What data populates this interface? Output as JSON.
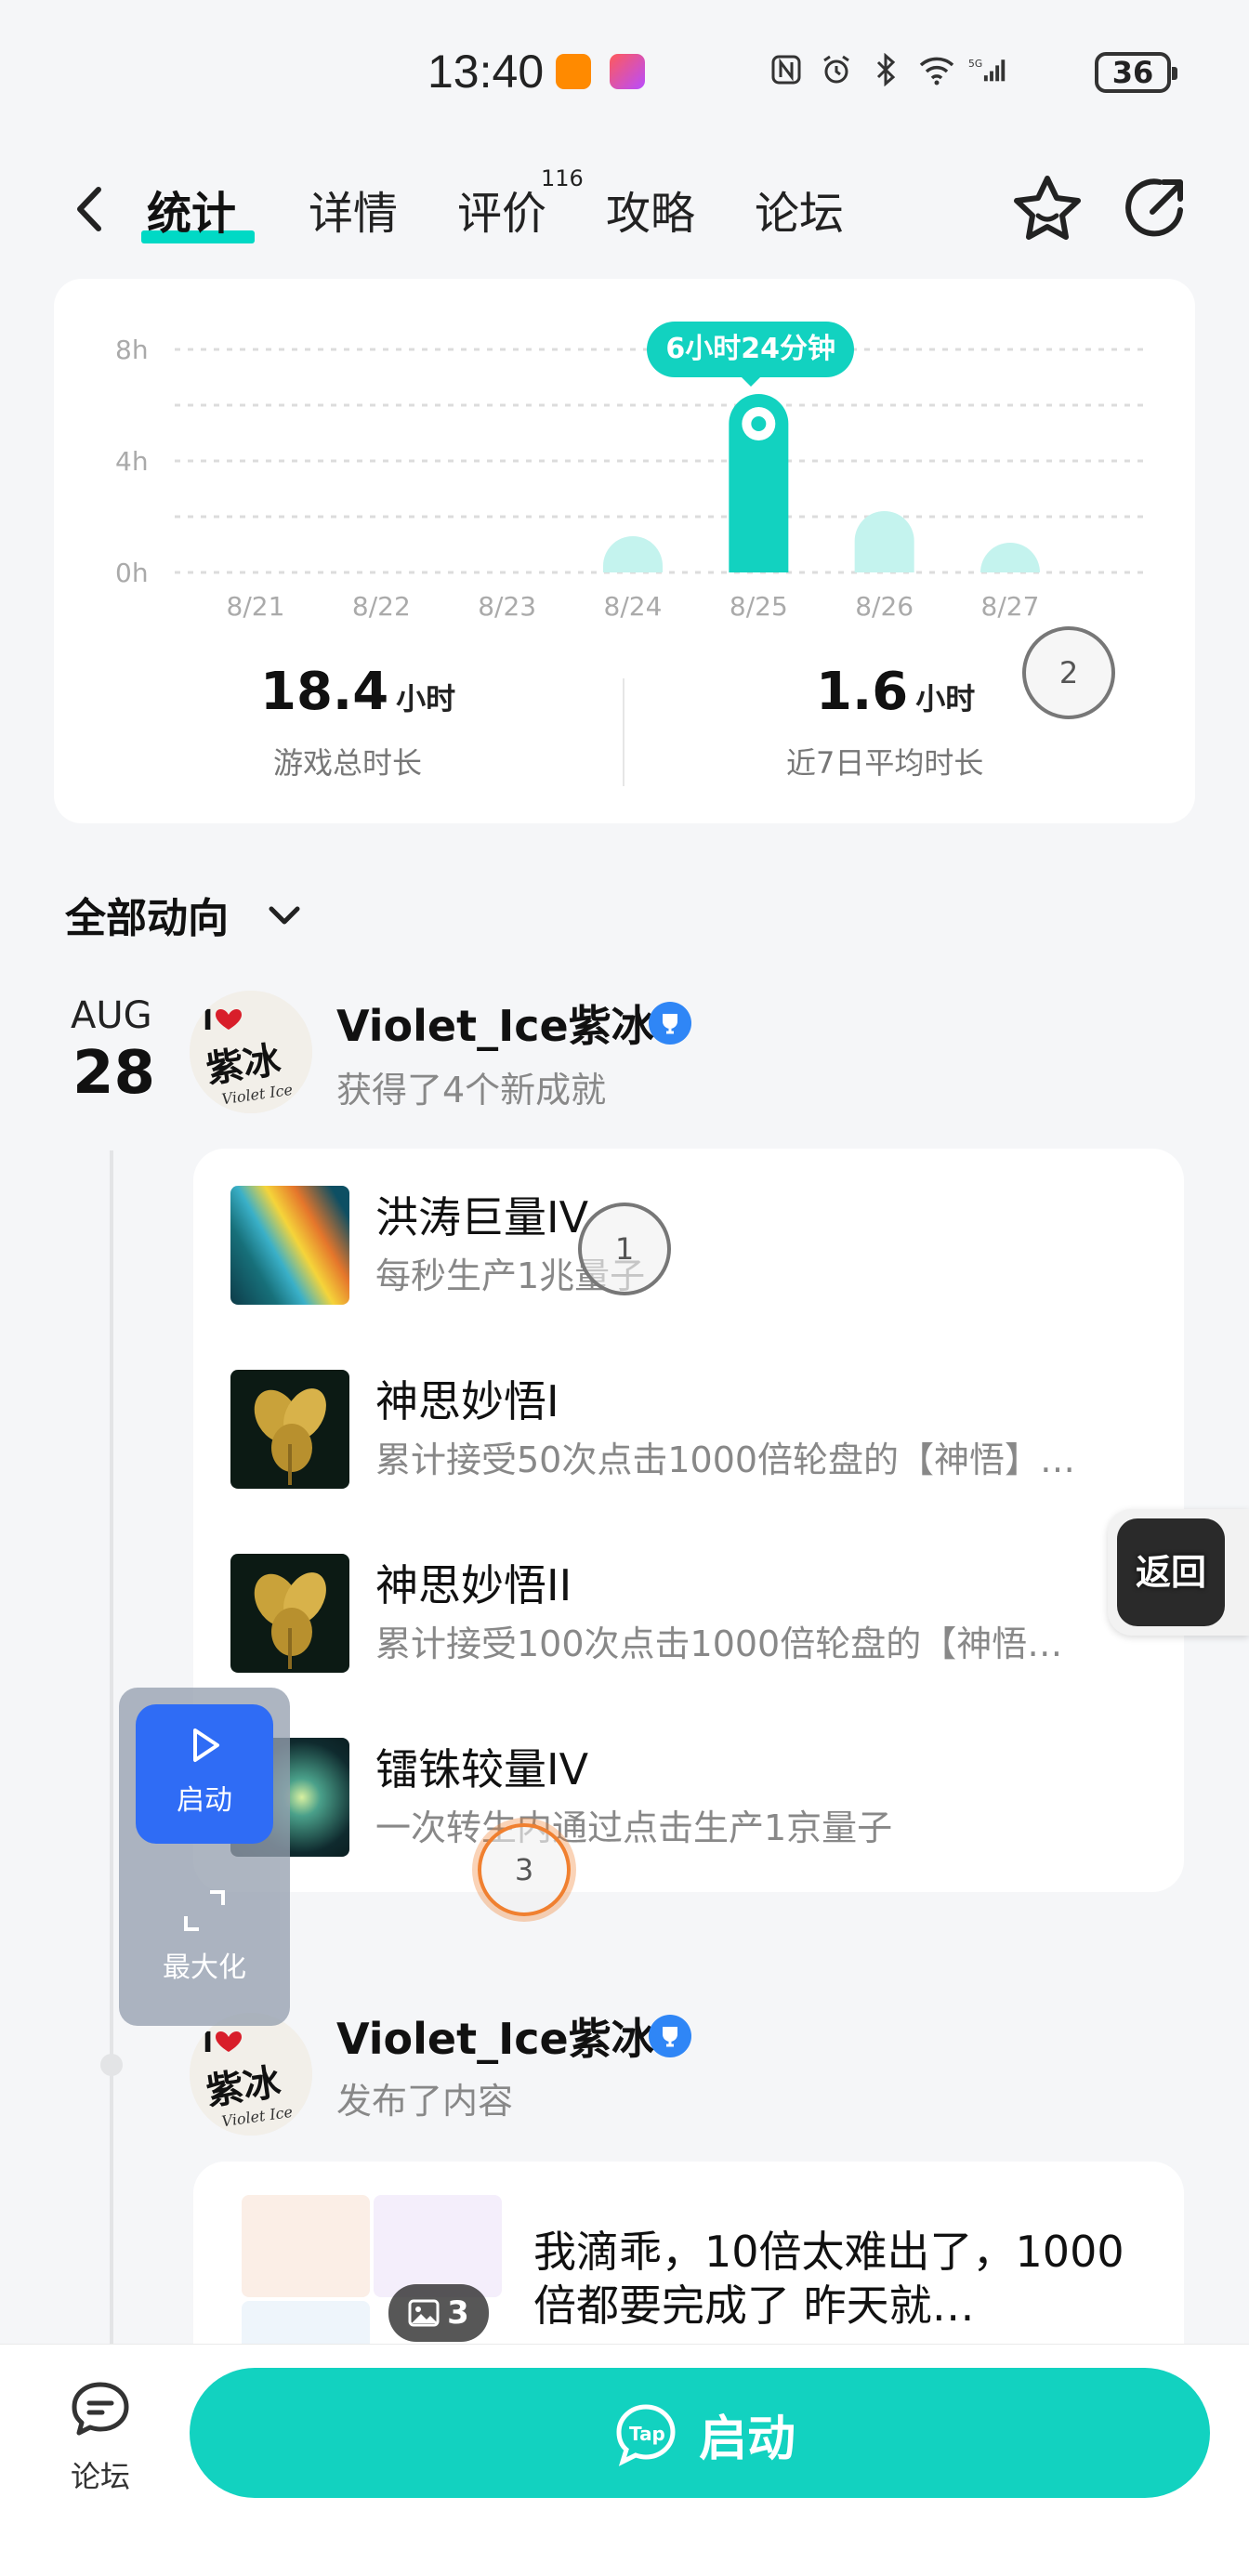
{
  "status_bar": {
    "time": "13:40",
    "battery": "36",
    "icons": [
      "nfc-icon",
      "alarm-icon",
      "bluetooth-icon",
      "wifi-icon",
      "5g-signal-icon"
    ]
  },
  "nav": {
    "tabs": [
      {
        "label": "统计",
        "active": true
      },
      {
        "label": "详情"
      },
      {
        "label": "评价",
        "badge": "116"
      },
      {
        "label": "攻略"
      },
      {
        "label": "论坛"
      }
    ]
  },
  "chart_data": {
    "type": "bar",
    "categories": [
      "8/21",
      "8/22",
      "8/23",
      "8/24",
      "8/25",
      "8/26",
      "8/27"
    ],
    "values": [
      0,
      0,
      0,
      1.3,
      6.4,
      2.2,
      0.6
    ],
    "y_ticks": [
      "0h",
      "4h",
      "8h"
    ],
    "ylim": [
      0,
      8
    ],
    "highlight_index": 4,
    "tooltip": "6小时24分钟",
    "colors": {
      "highlight": "#12d2c0",
      "normal": "#c4f3ee",
      "grid": "#dcdcdc"
    }
  },
  "stats": {
    "total_value": "18.4",
    "total_unit": "小时",
    "total_label": "游戏总时长",
    "avg_value": "1.6",
    "avg_unit": "小时",
    "avg_label": "近7日平均时长"
  },
  "feed": {
    "filter_label": "全部动向",
    "date_month": "AUG",
    "date_day": "28",
    "entries": [
      {
        "user": "Violet_Ice紫冰",
        "action": "获得了4个新成就"
      },
      {
        "user": "Violet_Ice紫冰",
        "action": "发布了内容"
      }
    ],
    "achievements": [
      {
        "name": "洪涛巨量IV",
        "desc": "每秒生产1兆量子"
      },
      {
        "name": "神思妙悟I",
        "desc": "累计接受50次点击1000倍轮盘的【神悟】…"
      },
      {
        "name": "神思妙悟II",
        "desc": "累计接受100次点击1000倍轮盘的【神悟…"
      },
      {
        "name": "镭铢较量IV",
        "desc": "一次转生内通过点击生产1京量子"
      }
    ],
    "post": {
      "text": "我滴乖，10倍太难出了，1000倍都要完成了 昨天就…",
      "image_count": "3"
    }
  },
  "floating": {
    "start_label": "启动",
    "maximize_label": "最大化",
    "return_label": "返回"
  },
  "markers": [
    "1",
    "2",
    "3"
  ],
  "bottom": {
    "forum_label": "论坛",
    "launch_label": "启动"
  }
}
